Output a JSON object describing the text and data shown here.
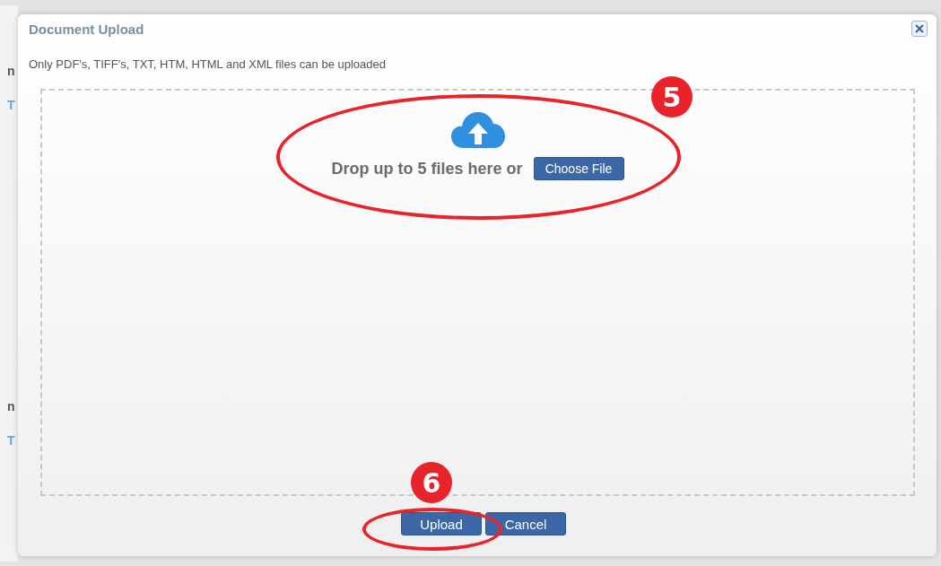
{
  "background_page": {
    "texts": [
      "n",
      "T",
      "n",
      "T"
    ]
  },
  "dialog": {
    "title": "Document Upload",
    "note": "Only PDF's, TIFF's, TXT, HTM, HTML and XML files can be uploaded",
    "dropzone": {
      "prompt": "Drop up to 5 files here or",
      "button": "Choose File"
    },
    "buttons": [
      "Upload",
      "Cancel"
    ]
  },
  "annotations": [
    "5",
    "6"
  ]
}
